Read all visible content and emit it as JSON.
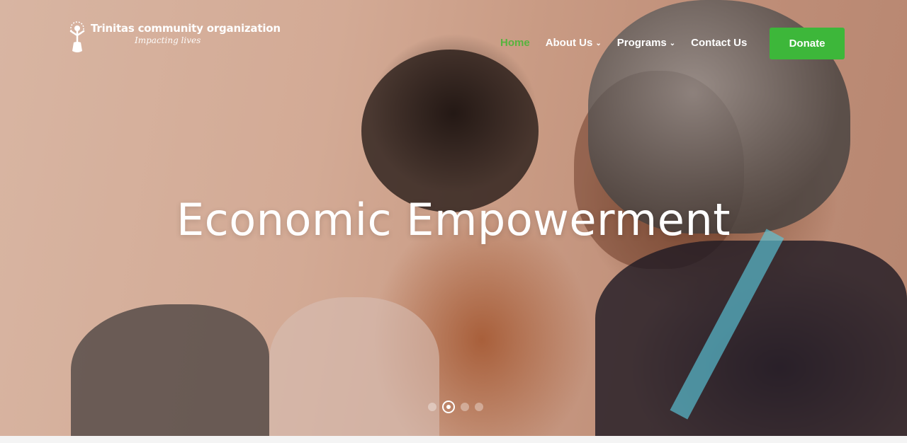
{
  "brand": {
    "name": "Trinitas community organization",
    "tagline": "Impacting lives"
  },
  "nav": {
    "items": [
      {
        "label": "Home",
        "active": true
      },
      {
        "label": "About Us",
        "dropdown": true
      },
      {
        "label": "Programs",
        "dropdown": true
      },
      {
        "label": "Contact Us"
      }
    ],
    "donate_label": "Donate"
  },
  "hero": {
    "headline": "Economic Empowerment",
    "slides_visible": 4,
    "active_slide": 2
  },
  "colors": {
    "accent_green": "#3db73a",
    "active_link": "#57b33e",
    "text": "#ffffff"
  }
}
